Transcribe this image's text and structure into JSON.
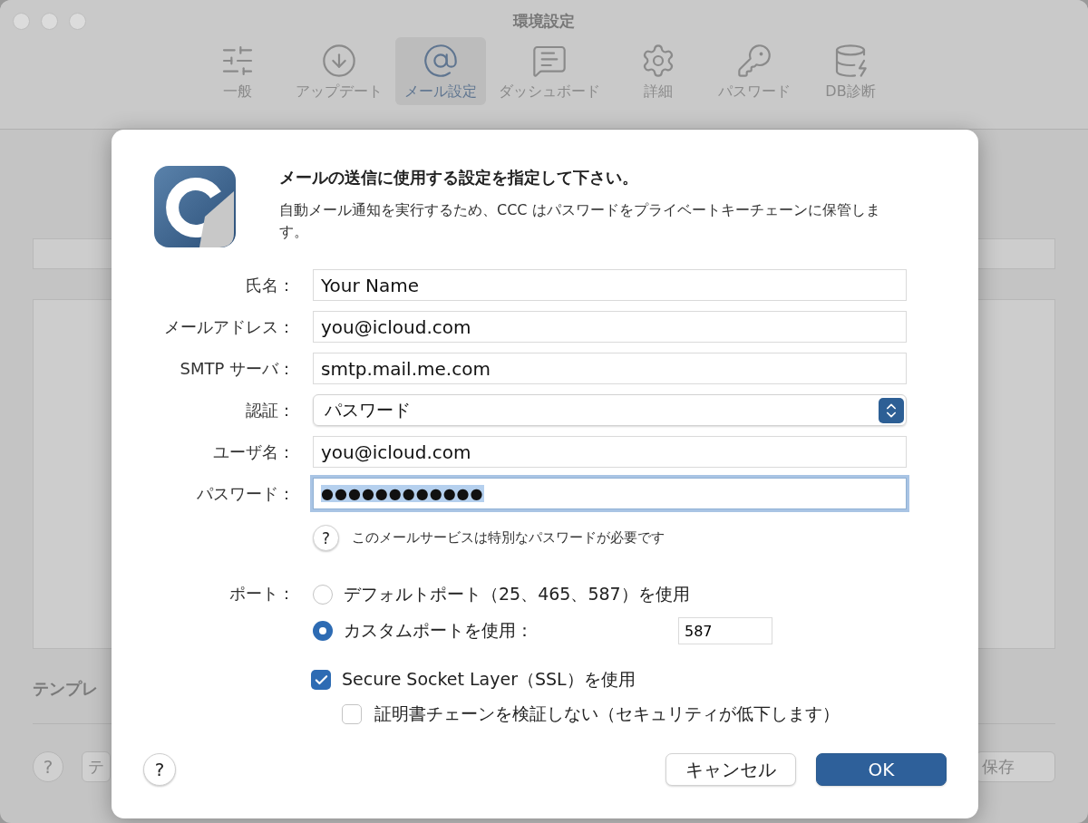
{
  "window": {
    "title": "環境設定"
  },
  "toolbar": {
    "tabs": [
      {
        "label": "一般",
        "selected": false
      },
      {
        "label": "アップデート",
        "selected": false
      },
      {
        "label": "メール設定",
        "selected": true
      },
      {
        "label": "ダッシュボード",
        "selected": false
      },
      {
        "label": "詳細",
        "selected": false
      },
      {
        "label": "パスワード",
        "selected": false
      },
      {
        "label": "DB診断",
        "selected": false
      }
    ]
  },
  "background": {
    "section_label": "テンプレ",
    "help_button": "?",
    "footer_button": "テ",
    "save_button": "保存"
  },
  "sheet": {
    "title": "メールの送信に使用する設定を指定して下さい。",
    "description": "自動メール通知を実行するため、CCC はパスワードをプライベートキーチェーンに保管します。",
    "fields": [
      {
        "kind": "text",
        "label": "氏名：",
        "value": "Your Name"
      },
      {
        "kind": "text",
        "label": "メールアドレス：",
        "value": "you@icloud.com"
      },
      {
        "kind": "text",
        "label": "SMTP サーバ：",
        "value": "smtp.mail.me.com"
      },
      {
        "kind": "select",
        "label": "認証：",
        "value": "パスワード"
      },
      {
        "kind": "text",
        "label": "ユーザ名：",
        "value": "you@icloud.com"
      },
      {
        "kind": "password",
        "label": "パスワード：",
        "value": "●●●●●●●●●●●●",
        "focused": true
      }
    ],
    "password_help_button": "?",
    "password_help": "このメールサービスは特別なパスワードが必要です",
    "help_button": "?",
    "port": {
      "label": "ポート：",
      "options": [
        {
          "label": "デフォルトポート（25、465、587）を使用",
          "selected": false
        },
        {
          "label": "カスタムポートを使用：",
          "selected": true
        }
      ],
      "custom_value": "587"
    },
    "ssl": {
      "label": "Secure Socket Layer（SSL）を使用",
      "checked": true
    },
    "skip_verify": {
      "label": "証明書チェーンを検証しない（セキュリティが低下します）",
      "checked": false
    },
    "buttons": {
      "cancel": "キャンセル",
      "ok": "OK"
    }
  }
}
